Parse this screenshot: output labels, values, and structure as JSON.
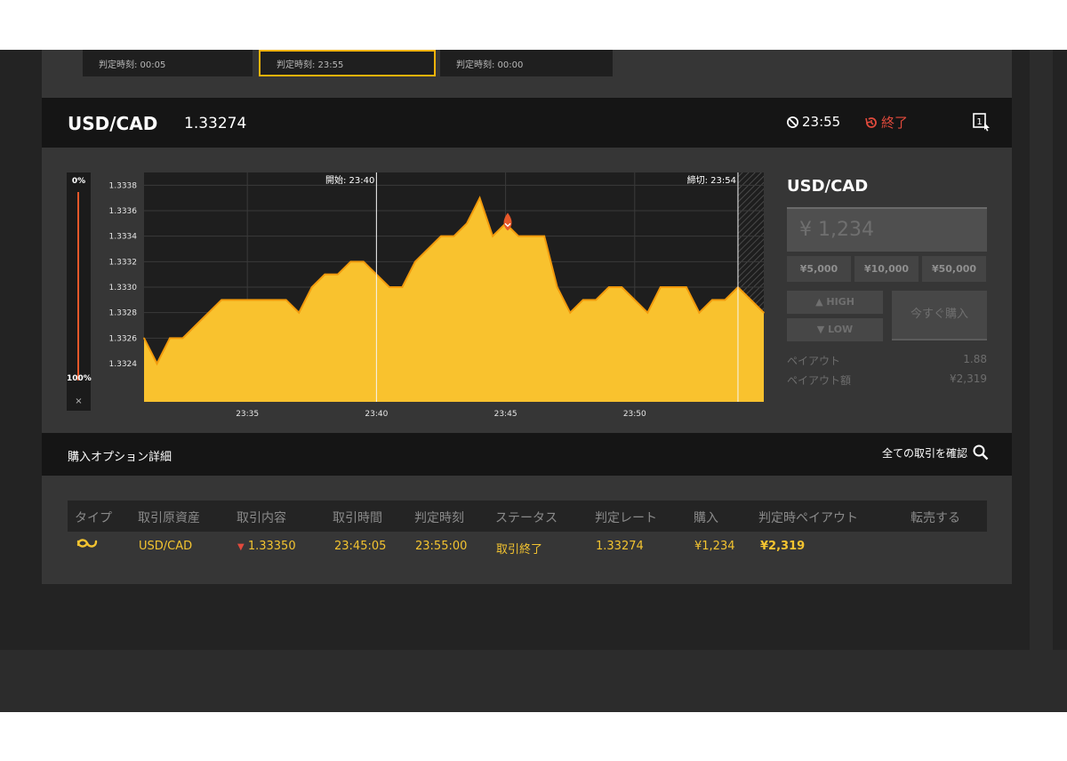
{
  "expiry_cards": [
    {
      "label": "判定時刻: 00:05"
    },
    {
      "label": "判定時刻: 23:55"
    },
    {
      "label": "判定時刻: 00:00"
    }
  ],
  "header": {
    "pair": "USD/CAD",
    "rate": "1.33274",
    "countdown": "23:55",
    "status": "終了"
  },
  "slider": {
    "top_label": "0%",
    "bottom_label": "100%",
    "close": "×"
  },
  "chart_data": {
    "type": "area",
    "xlabel": "",
    "ylabel": "",
    "x_ticks": [
      "23:35",
      "23:40",
      "23:45",
      "23:50"
    ],
    "y_ticks": [
      "1.3338",
      "1.3336",
      "1.3334",
      "1.3332",
      "1.3330",
      "1.3328",
      "1.3326",
      "1.3324"
    ],
    "ylim": [
      1.3321,
      1.3339
    ],
    "start_label": "開始: 23:40",
    "close_label": "締切: 23:54",
    "entry_rate": 1.3335,
    "series": [
      {
        "x": [
          "23:31:00",
          "23:31:30",
          "23:32:00",
          "23:32:30",
          "23:33:00",
          "23:33:30",
          "23:34:00",
          "23:34:30",
          "23:35:00",
          "23:35:30",
          "23:36:00",
          "23:36:30",
          "23:37:00",
          "23:37:30",
          "23:38:00",
          "23:38:30",
          "23:39:00",
          "23:39:30",
          "23:40:00",
          "23:40:30",
          "23:41:00",
          "23:41:30",
          "23:42:00",
          "23:42:30",
          "23:43:00",
          "23:43:30",
          "23:44:00",
          "23:44:30",
          "23:45:00",
          "23:45:30",
          "23:46:00",
          "23:46:30",
          "23:47:00",
          "23:47:30",
          "23:48:00",
          "23:48:30",
          "23:49:00",
          "23:49:30",
          "23:50:00",
          "23:50:30",
          "23:51:00",
          "23:51:30",
          "23:52:00",
          "23:52:30",
          "23:53:00",
          "23:53:30",
          "23:54:00",
          "23:54:30",
          "23:55:00"
        ],
        "values": [
          1.3326,
          1.3324,
          1.3326,
          1.3326,
          1.3327,
          1.3328,
          1.3329,
          1.3329,
          1.3329,
          1.3329,
          1.3329,
          1.3329,
          1.3328,
          1.333,
          1.3331,
          1.3331,
          1.3332,
          1.3332,
          1.3331,
          1.333,
          1.333,
          1.3332,
          1.3333,
          1.3334,
          1.3334,
          1.3335,
          1.3337,
          1.3334,
          1.3335,
          1.3334,
          1.3334,
          1.3334,
          1.333,
          1.3328,
          1.3329,
          1.3329,
          1.333,
          1.333,
          1.3329,
          1.3328,
          1.333,
          1.333,
          1.333,
          1.3328,
          1.3329,
          1.3329,
          1.333,
          1.3329,
          1.3328
        ]
      }
    ]
  },
  "trade_panel": {
    "pair": "USD/CAD",
    "amount": "¥ 1,234",
    "presets": [
      "¥5,000",
      "¥10,000",
      "¥50,000"
    ],
    "high": "HIGH",
    "low": "LOW",
    "buy_now": "今すぐ購入",
    "payout_label": "ペイアウト",
    "payout_value": "1.88",
    "payout_amount_label": "ペイアウト額",
    "payout_amount_value": "¥2,319"
  },
  "details": {
    "title": "購入オプション詳細",
    "view_all": "全ての取引を確認"
  },
  "table": {
    "headers": [
      "タイプ",
      "取引原資産",
      "取引内容",
      "取引時間",
      "判定時刻",
      "ステータス",
      "判定レート",
      "購入",
      "判定時ペイアウト",
      "転売する"
    ],
    "row": {
      "asset": "USD/CAD",
      "content": "1.33350",
      "time": "23:45:05",
      "judge_time": "23:55:00",
      "status": "取引終了",
      "judge_rate": "1.33274",
      "purchase": "¥1,234",
      "payout": "¥2,319"
    }
  },
  "colors": {
    "accent": "#f4b30a",
    "area": "#f9c22e",
    "danger": "#e14a3c"
  }
}
